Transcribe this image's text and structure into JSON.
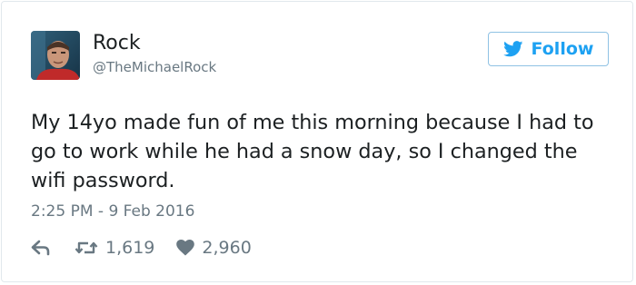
{
  "tweet": {
    "author": {
      "name": "Rock",
      "handle": "@TheMichaelRock",
      "avatar": "profile-photo"
    },
    "follow_button": {
      "label": "Follow",
      "icon": "twitter-bird-icon"
    },
    "text": "My 14yo made fun of me this morning because I had to go to work while he had a snow day, so I changed the wifi password.",
    "timestamp": "2:25 PM - 9 Feb 2016",
    "actions": {
      "reply": {
        "icon": "reply-icon"
      },
      "retweet": {
        "icon": "retweet-icon",
        "count": "1,619"
      },
      "like": {
        "icon": "heart-icon",
        "count": "2,960"
      }
    }
  },
  "colors": {
    "brand": "#1da1f2",
    "text": "#1c2022",
    "muted": "#697882",
    "border": "#e1e8ed"
  }
}
